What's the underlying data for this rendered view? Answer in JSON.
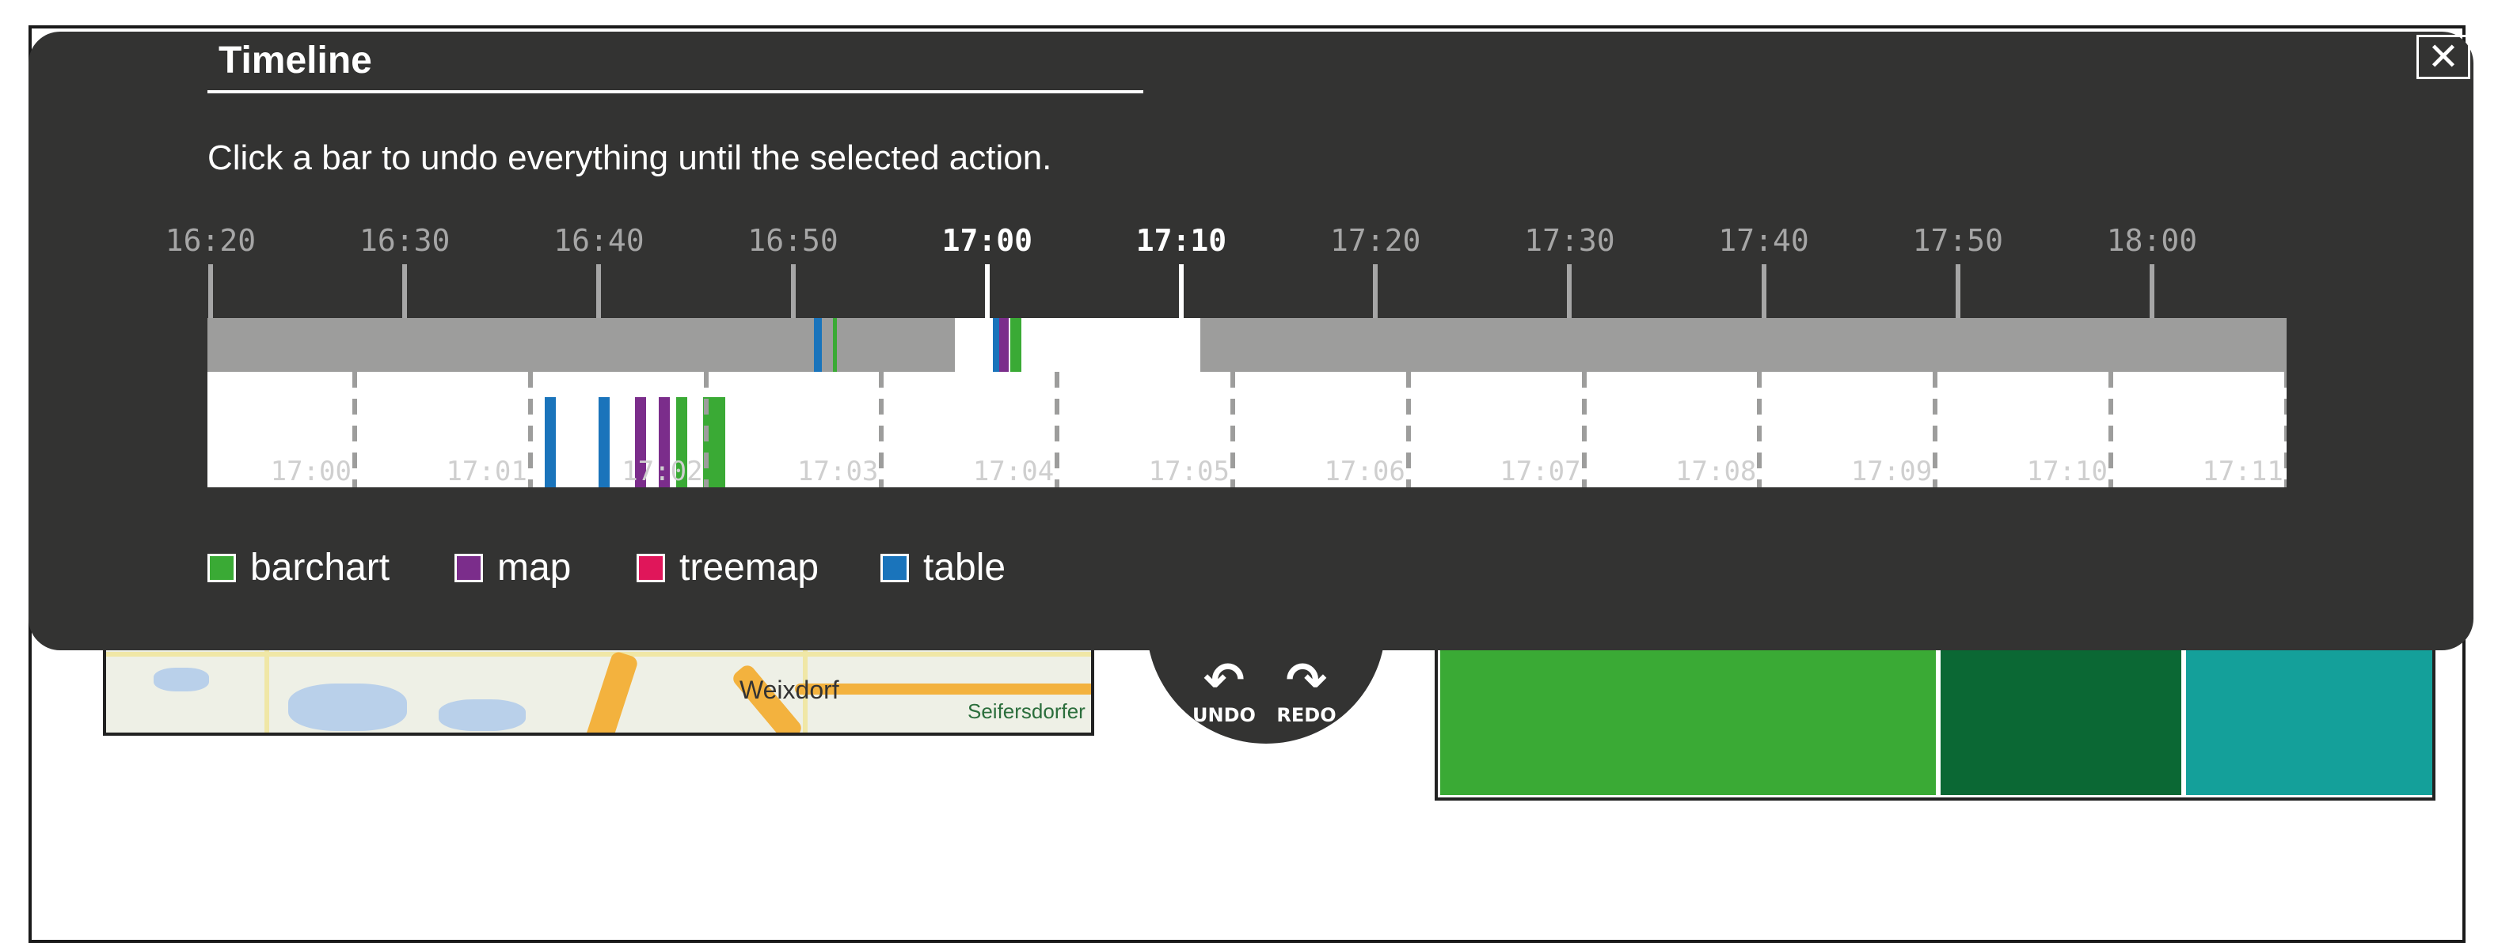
{
  "background": {
    "map": {
      "labels": [
        "Weixdorf",
        "Seifersdorfer"
      ]
    },
    "undo_redo": {
      "undo_label": "UNDO",
      "redo_label": "REDO",
      "undo_icon": "undo-arrow-icon",
      "redo_icon": "redo-arrow-icon"
    },
    "treemap": {
      "colors": [
        "#3aaa35",
        "#0b6834",
        "#14a09a"
      ]
    }
  },
  "timeline_overlay": {
    "title": "Timeline",
    "close_label": "✕",
    "instruction": "Click a bar to undo everything until the selected action.",
    "overview_ticks": [
      "16:20",
      "16:30",
      "16:40",
      "16:50",
      "17:00",
      "17:10",
      "17:20",
      "17:30",
      "17:40",
      "17:50",
      "18:00"
    ],
    "highlighted_ticks": [
      "17:00",
      "17:10"
    ],
    "detail_ticks": [
      "17:00",
      "17:01",
      "17:02",
      "17:03",
      "17:04",
      "17:05",
      "17:06",
      "17:07",
      "17:08",
      "17:09",
      "17:10",
      "17:11"
    ],
    "legend": [
      {
        "label": "barchart",
        "color": "#3aaa35"
      },
      {
        "label": "map",
        "color": "#7b2d8b"
      },
      {
        "label": "treemap",
        "color": "#e0165a"
      },
      {
        "label": "table",
        "color": "#1a74bb"
      }
    ]
  }
}
